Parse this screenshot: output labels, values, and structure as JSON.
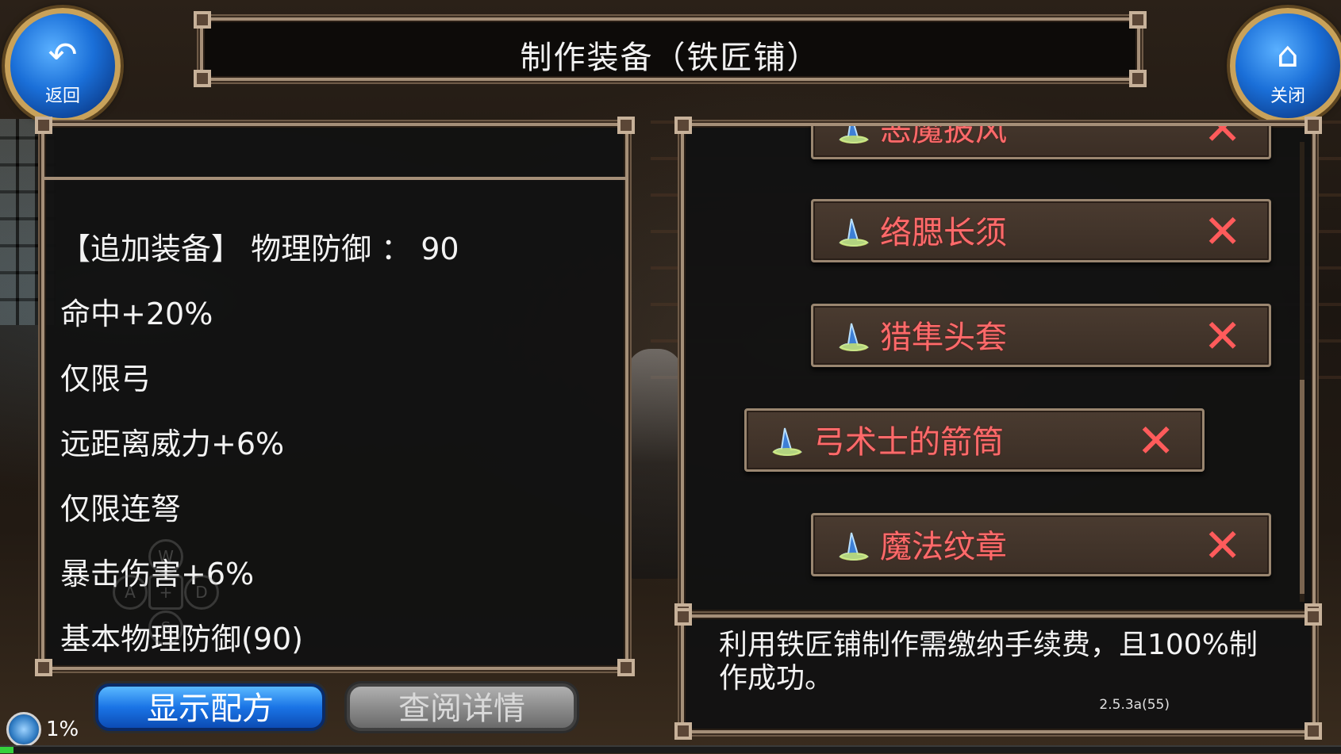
{
  "title": "制作装备（铁匠铺）",
  "back_button": {
    "label": "返回",
    "icon": "back-arrow-icon"
  },
  "close_button": {
    "label": "关闭",
    "icon": "home-icon"
  },
  "description": {
    "lines": [
      "【追加装备】 物理防御 ：  90",
      "命中+20%",
      "仅限弓",
      "远距离威力+6%",
      "仅限连弩",
      "暴击伤害+6%",
      "基本物理防御(90)"
    ]
  },
  "dpad": {
    "up": "W",
    "left": "A",
    "right": "D",
    "down": "S"
  },
  "recipe_list": {
    "items": [
      {
        "name": "恶魔披风",
        "remove": "✕"
      },
      {
        "name": "络腮长须",
        "remove": "✕"
      },
      {
        "name": "猎隼头套",
        "remove": "✕"
      },
      {
        "name": "弓术士的箭筒",
        "remove": "✕",
        "selected": true
      },
      {
        "name": "魔法纹章",
        "remove": "✕"
      }
    ],
    "item_icon": "wizard-hat-icon",
    "item_text_color": "#ff6a6a"
  },
  "notice": {
    "text": "利用铁匠铺制作需缴纳手续费，且100%制作成功。"
  },
  "buttons": {
    "show_recipe": "显示配方",
    "view_details": "查阅详情"
  },
  "status": {
    "exp_percent": "1%",
    "exp_fraction": 0.01,
    "version": "2.5.3a(55)"
  }
}
